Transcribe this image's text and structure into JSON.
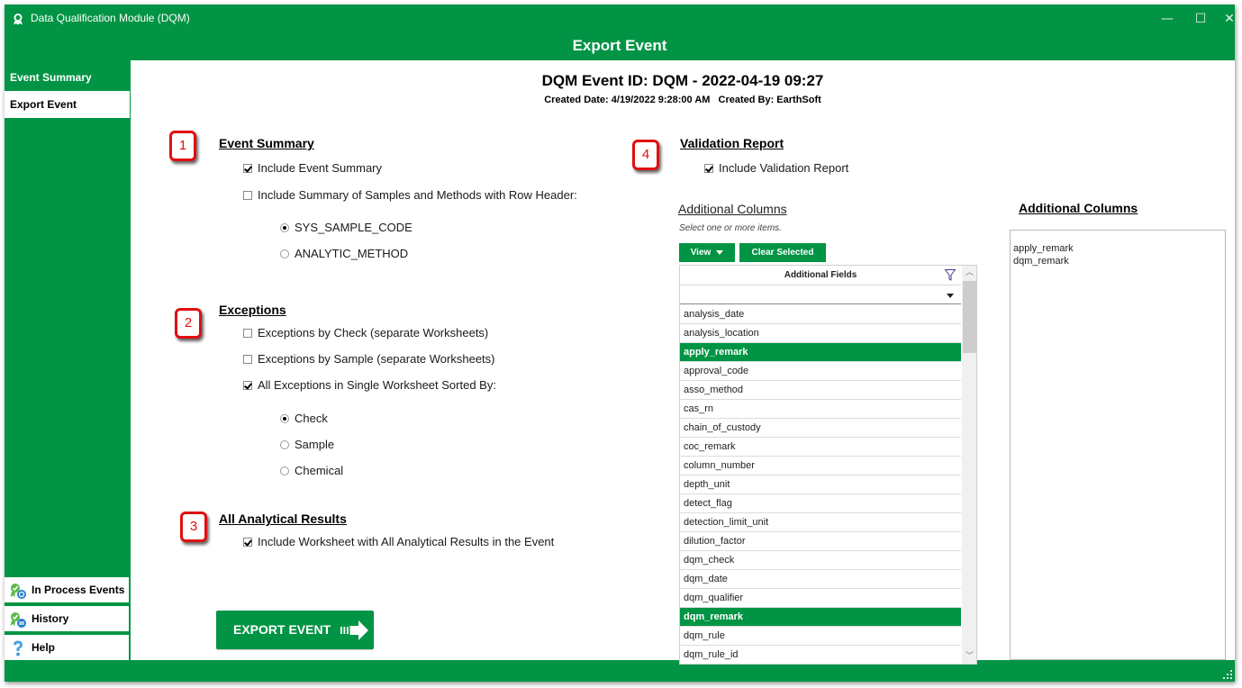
{
  "window": {
    "app_title": "Data Qualification Module (DQM)",
    "controls": {
      "minimize": "—",
      "maximize": "☐",
      "close": "✕"
    }
  },
  "header": {
    "title": "Export Event"
  },
  "sidebar": {
    "items": [
      {
        "label": "Event Summary",
        "active": false
      },
      {
        "label": "Export Event",
        "active": true
      }
    ],
    "bottom_items": [
      {
        "label": "In Process Events",
        "icon": "in-process-events-icon"
      },
      {
        "label": "History",
        "icon": "history-icon"
      },
      {
        "label": "Help",
        "icon": "help-question-icon"
      }
    ]
  },
  "event": {
    "id_line": "DQM Event ID: DQM - 2022-04-19 09:27",
    "created_date": "Created Date: 4/19/2022 9:28:00 AM",
    "created_by": "Created By:  EarthSoft"
  },
  "sections": {
    "event_summary": {
      "badge": "1",
      "title": "Event Summary",
      "include_summary": {
        "label": "Include Event Summary",
        "checked": true
      },
      "include_samples": {
        "label": "Include Summary of Samples and Methods with Row Header:",
        "checked": false
      },
      "row_header_options": [
        {
          "label": "SYS_SAMPLE_CODE",
          "selected": true
        },
        {
          "label": "ANALYTIC_METHOD",
          "selected": false
        }
      ]
    },
    "exceptions": {
      "badge": "2",
      "title": "Exceptions",
      "by_check": {
        "label": "Exceptions by Check (separate Worksheets)",
        "checked": false
      },
      "by_sample": {
        "label": "Exceptions by Sample (separate Worksheets)",
        "checked": false
      },
      "single_sheet": {
        "label": "All Exceptions in Single Worksheet Sorted By:",
        "checked": true
      },
      "sort_options": [
        {
          "label": "Check",
          "selected": true
        },
        {
          "label": "Sample",
          "selected": false
        },
        {
          "label": "Chemical",
          "selected": false
        }
      ]
    },
    "analytical": {
      "badge": "3",
      "title": "All Analytical Results",
      "include_results": {
        "label": "Include Worksheet with All Analytical Results in the Event",
        "checked": true
      }
    },
    "validation": {
      "badge": "4",
      "title": "Validation Report",
      "include_report": {
        "label": "Include Validation Report",
        "checked": true
      }
    }
  },
  "export_button": {
    "label": "EXPORT EVENT"
  },
  "additional_columns": {
    "label": "Additional Columns",
    "hint": "Select one or more items.",
    "view_button": "View",
    "clear_button": "Clear Selected",
    "grid_header": "Additional Fields",
    "filter_value": "",
    "rows": [
      {
        "name": "analysis_date",
        "selected": false
      },
      {
        "name": "analysis_location",
        "selected": false
      },
      {
        "name": "apply_remark",
        "selected": true
      },
      {
        "name": "approval_code",
        "selected": false
      },
      {
        "name": "asso_method",
        "selected": false
      },
      {
        "name": "cas_rn",
        "selected": false
      },
      {
        "name": "chain_of_custody",
        "selected": false
      },
      {
        "name": "coc_remark",
        "selected": false
      },
      {
        "name": "column_number",
        "selected": false
      },
      {
        "name": "depth_unit",
        "selected": false
      },
      {
        "name": "detect_flag",
        "selected": false
      },
      {
        "name": "detection_limit_unit",
        "selected": false
      },
      {
        "name": "dilution_factor",
        "selected": false
      },
      {
        "name": "dqm_check",
        "selected": false
      },
      {
        "name": "dqm_date",
        "selected": false
      },
      {
        "name": "dqm_qualifier",
        "selected": false
      },
      {
        "name": "dqm_remark",
        "selected": true
      },
      {
        "name": "dqm_rule",
        "selected": false
      },
      {
        "name": "dqm_rule_id",
        "selected": false
      }
    ]
  },
  "selected_columns": {
    "title": "Additional Columns",
    "items": [
      "apply_remark",
      "dqm_remark"
    ]
  },
  "colors": {
    "brand_green": "#019444",
    "badge_red": "#e01010"
  }
}
